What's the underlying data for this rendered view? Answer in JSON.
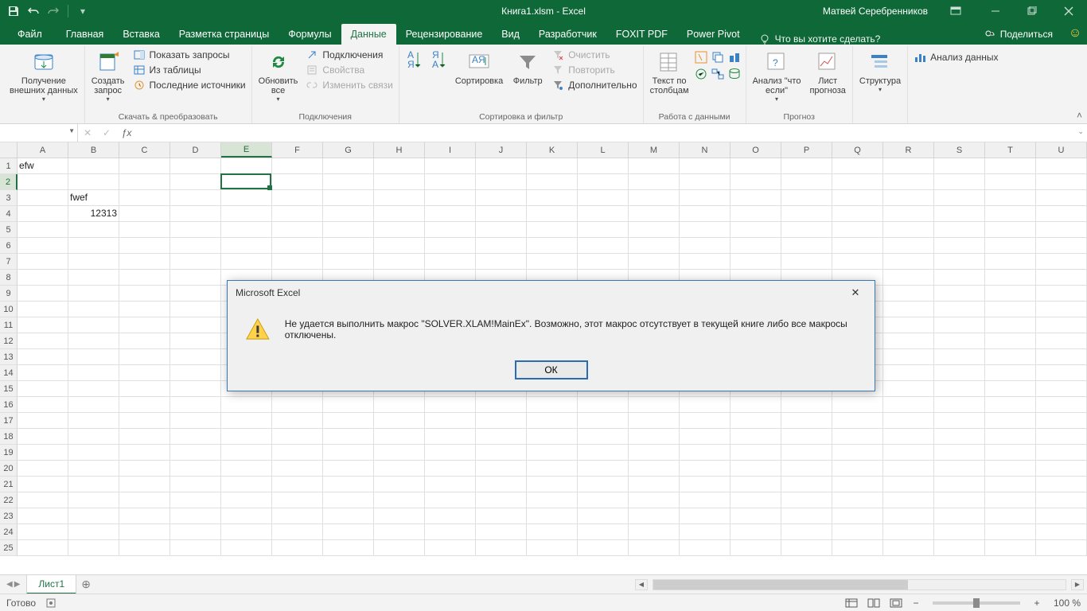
{
  "titlebar": {
    "title": "Книга1.xlsm  -  Excel",
    "user": "Матвей Серебренников"
  },
  "menu": {
    "file": "Файл",
    "home": "Главная",
    "insert": "Вставка",
    "layout": "Разметка страницы",
    "formulas": "Формулы",
    "data": "Данные",
    "review": "Рецензирование",
    "view": "Вид",
    "developer": "Разработчик",
    "foxit": "FOXIT PDF",
    "powerpivot": "Power Pivot",
    "tellme": "Что вы хотите сделать?",
    "share": "Поделиться"
  },
  "ribbon": {
    "g1": {
      "get": "Получение\nвнешних данных",
      "label": ""
    },
    "g2": {
      "new": "Создать\nзапрос",
      "show": "Показать запросы",
      "table": "Из таблицы",
      "recent": "Последние источники",
      "label": "Скачать & преобразовать"
    },
    "g3": {
      "refresh": "Обновить\nвсе",
      "conn": "Подключения",
      "props": "Свойства",
      "edit": "Изменить связи",
      "label": "Подключения"
    },
    "g4": {
      "sort": "Сортировка",
      "filter": "Фильтр",
      "clear": "Очистить",
      "reapply": "Повторить",
      "adv": "Дополнительно",
      "label": "Сортировка и фильтр"
    },
    "g5": {
      "text": "Текст по\nстолбцам",
      "label": "Работа с данными"
    },
    "g6": {
      "whatif": "Анализ \"что\nесли\"",
      "forecast": "Лист\nпрогноза",
      "label": "Прогноз"
    },
    "g7": {
      "outline": "Структура",
      "label": ""
    },
    "g8": {
      "analysis": "Анализ данных",
      "label": ""
    }
  },
  "namebox": "",
  "columns": [
    "A",
    "B",
    "C",
    "D",
    "E",
    "F",
    "G",
    "H",
    "I",
    "J",
    "K",
    "L",
    "M",
    "N",
    "O",
    "P",
    "Q",
    "R",
    "S",
    "T",
    "U"
  ],
  "rows": 25,
  "selected": {
    "row": 2,
    "col": 5
  },
  "cells": {
    "r1c1": "efw",
    "r3c2": "fwef",
    "r4c2": "12313"
  },
  "sheet_tab": "Лист1",
  "status": {
    "ready": "Готово",
    "zoom": "100 %"
  },
  "dialog": {
    "title": "Microsoft Excel",
    "msg": "Не удается выполнить макрос \"SOLVER.XLAM!MainEx\". Возможно, этот макрос отсутствует в текущей книге либо все макросы отключены.",
    "ok": "ОК"
  }
}
